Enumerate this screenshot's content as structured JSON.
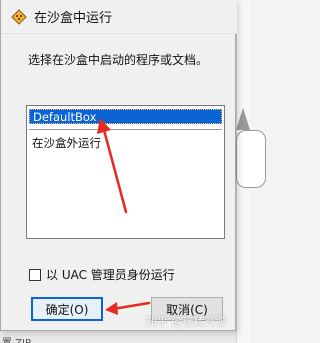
{
  "window": {
    "title": "在沙盒中运行"
  },
  "prompt": "选择在沙盒中启动的程序或文档。",
  "sandbox_list": {
    "items": [
      {
        "label": "DefaultBox",
        "selected": true
      },
      {
        "label": "在沙盒外运行",
        "selected": false
      }
    ]
  },
  "uac_option": {
    "label": "以 UAC 管理员身份运行",
    "checked": false
  },
  "buttons": {
    "ok": "确定(O)",
    "cancel": "取消(C)"
  },
  "background": {
    "bottom_text": "置 ZIP"
  },
  "watermark": "知乎 @玩转开源",
  "colors": {
    "selection": "#0a64d4",
    "arrow": "#e8291f"
  }
}
